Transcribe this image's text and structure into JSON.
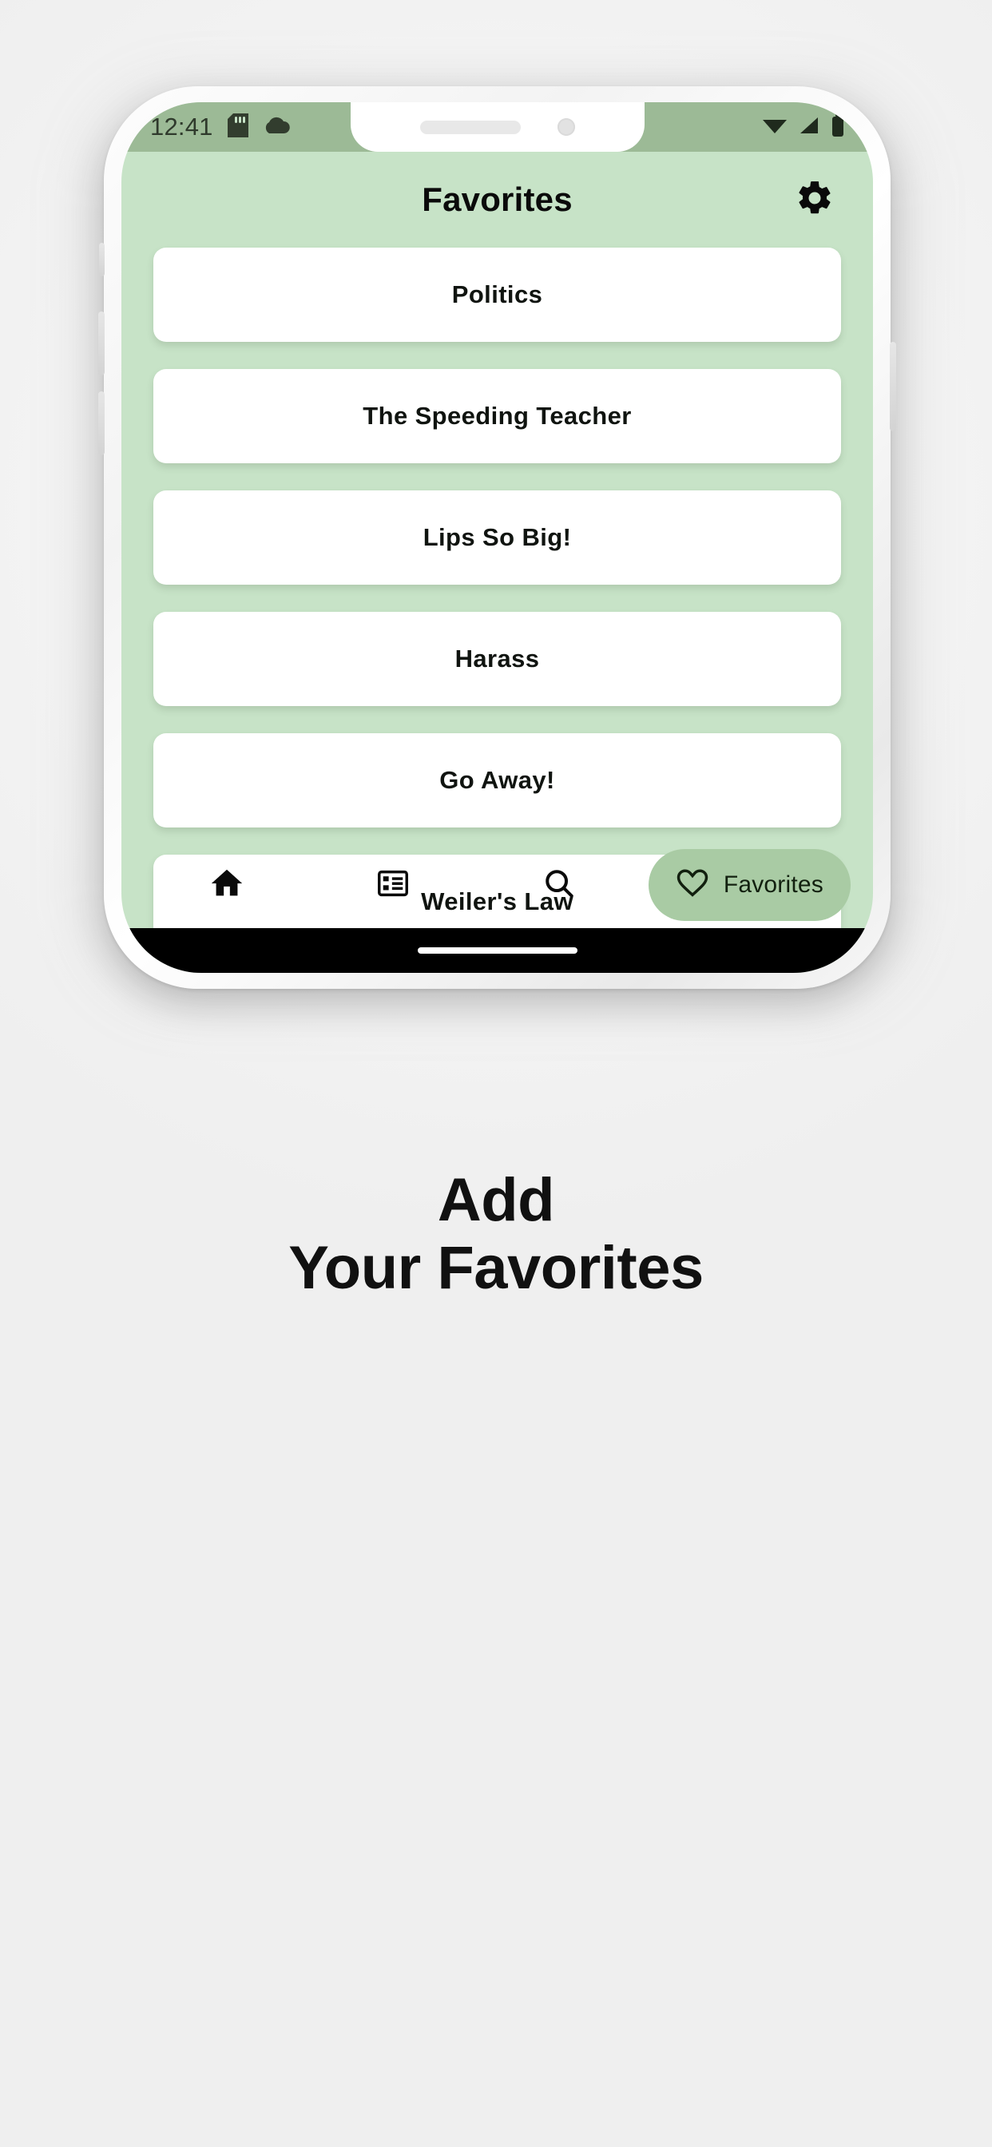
{
  "colors": {
    "page_background": "#f2f2f2",
    "app_background": "#c7e3c7",
    "status_bar": "#9cba96",
    "card": "#ffffff",
    "selected_pill": "#a9cba4",
    "text": "#101410"
  },
  "status_bar": {
    "time": "12:41",
    "left_icons": [
      "sd-card-icon",
      "cloud-icon"
    ],
    "right_icons": [
      "wifi-icon",
      "cellular-signal-icon",
      "battery-icon"
    ]
  },
  "header": {
    "title": "Favorites",
    "settings_icon": "gear-icon"
  },
  "cards": [
    {
      "label": "Politics"
    },
    {
      "label": "The Speeding Teacher"
    },
    {
      "label": "Lips So Big!"
    },
    {
      "label": "Harass"
    },
    {
      "label": "Go Away!"
    },
    {
      "label": "Weiler's Law"
    }
  ],
  "bottom_nav": {
    "items": [
      {
        "icon": "home-icon",
        "label": "",
        "selected": false
      },
      {
        "icon": "list-icon",
        "label": "",
        "selected": false
      },
      {
        "icon": "search-icon",
        "label": "",
        "selected": false
      },
      {
        "icon": "heart-icon",
        "label": "Favorites",
        "selected": true
      }
    ]
  },
  "caption": {
    "line1": "Add",
    "line2": "Your Favorites"
  }
}
